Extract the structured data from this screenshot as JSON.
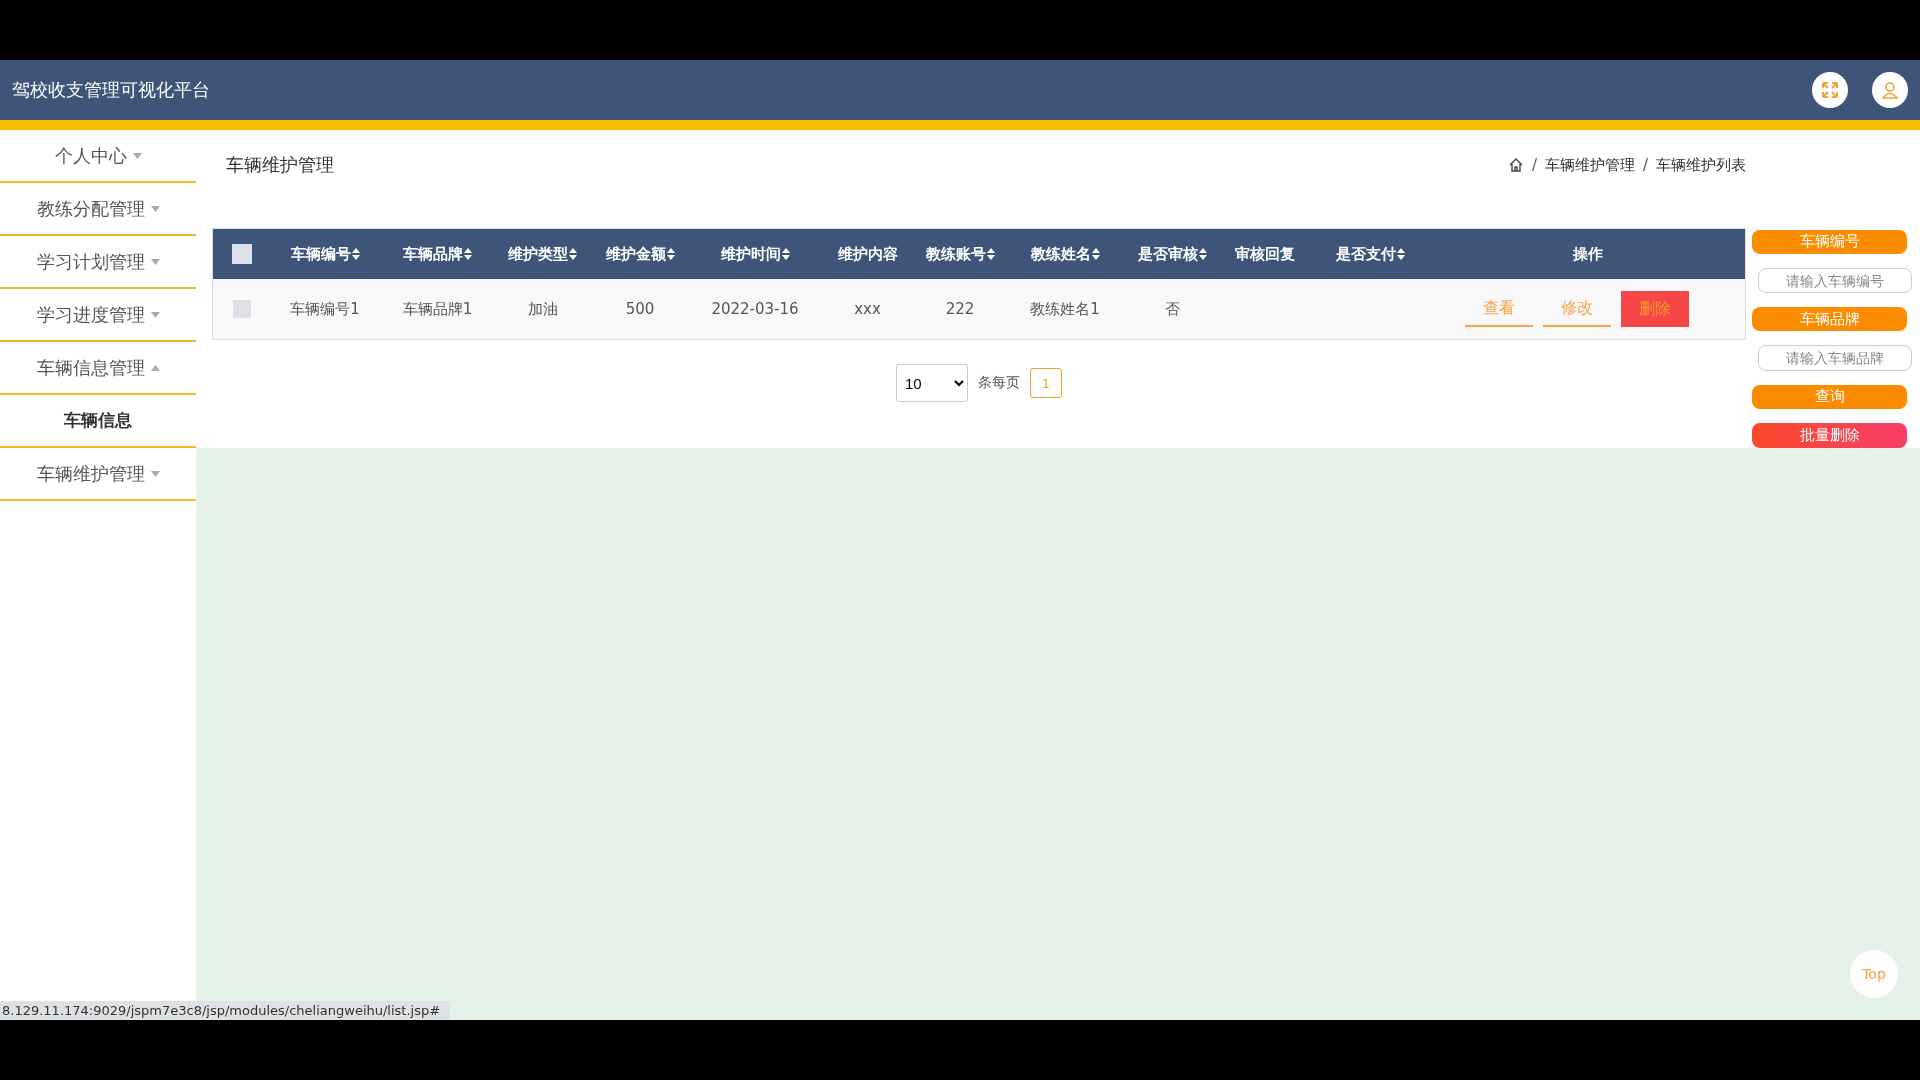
{
  "header": {
    "title": "驾校收支管理可视化平台"
  },
  "sidebar": {
    "items": [
      {
        "label": "个人中心",
        "kind": "menu",
        "expanded": false
      },
      {
        "label": "教练分配管理",
        "kind": "menu",
        "expanded": false
      },
      {
        "label": "学习计划管理",
        "kind": "menu",
        "expanded": false
      },
      {
        "label": "学习进度管理",
        "kind": "menu",
        "expanded": false
      },
      {
        "label": "车辆信息管理",
        "kind": "menu",
        "expanded": true
      },
      {
        "label": "车辆信息",
        "kind": "submenu"
      },
      {
        "label": "车辆维护管理",
        "kind": "menu",
        "expanded": false
      }
    ]
  },
  "page": {
    "title": "车辆维护管理",
    "breadcrumb": [
      {
        "label": "/",
        "kind": "separator"
      },
      {
        "label": "车辆维护管理",
        "kind": "link"
      },
      {
        "label": "/",
        "kind": "separator"
      },
      {
        "label": "车辆维护列表",
        "kind": "link"
      }
    ]
  },
  "table": {
    "select_all_checked": false,
    "columns": [
      {
        "label": "车辆编号",
        "sortable": true
      },
      {
        "label": "车辆品牌",
        "sortable": true
      },
      {
        "label": "维护类型",
        "sortable": true
      },
      {
        "label": "维护金额",
        "sortable": true
      },
      {
        "label": "维护时间",
        "sortable": true
      },
      {
        "label": "维护内容",
        "sortable": false
      },
      {
        "label": "教练账号",
        "sortable": true
      },
      {
        "label": "教练姓名",
        "sortable": true
      },
      {
        "label": "是否审核",
        "sortable": true
      },
      {
        "label": "审核回复",
        "sortable": false
      },
      {
        "label": "是否支付",
        "sortable": true
      },
      {
        "label": "操作",
        "sortable": false
      }
    ],
    "rows": [
      {
        "checked": false,
        "cells": [
          "车辆编号1",
          "车辆品牌1",
          "加油",
          "500",
          "2022-03-16",
          "xxx",
          "222",
          "教练姓名1",
          "否",
          "",
          ""
        ],
        "actions": [
          {
            "label": "查看",
            "kind": "view"
          },
          {
            "label": "修改",
            "kind": "edit"
          },
          {
            "label": "删除",
            "kind": "delete"
          }
        ]
      }
    ]
  },
  "pagination": {
    "page_size": "10",
    "per_page_label": "条每页",
    "pages": [
      {
        "label": "1",
        "selected": true
      }
    ]
  },
  "search_panel": {
    "fields": [
      {
        "label": "车辆编号",
        "placeholder": "请输入车辆编号"
      },
      {
        "label": "车辆品牌",
        "placeholder": "请输入车辆品牌"
      }
    ],
    "buttons": [
      {
        "label": "查询",
        "kind": "search"
      },
      {
        "label": "批量删除",
        "kind": "delete"
      }
    ]
  },
  "top_button": "Top",
  "status_url": "8.129.11.174:9029/jspm7e3c8/jsp/modules/cheliangweihu/list.jsp#"
}
